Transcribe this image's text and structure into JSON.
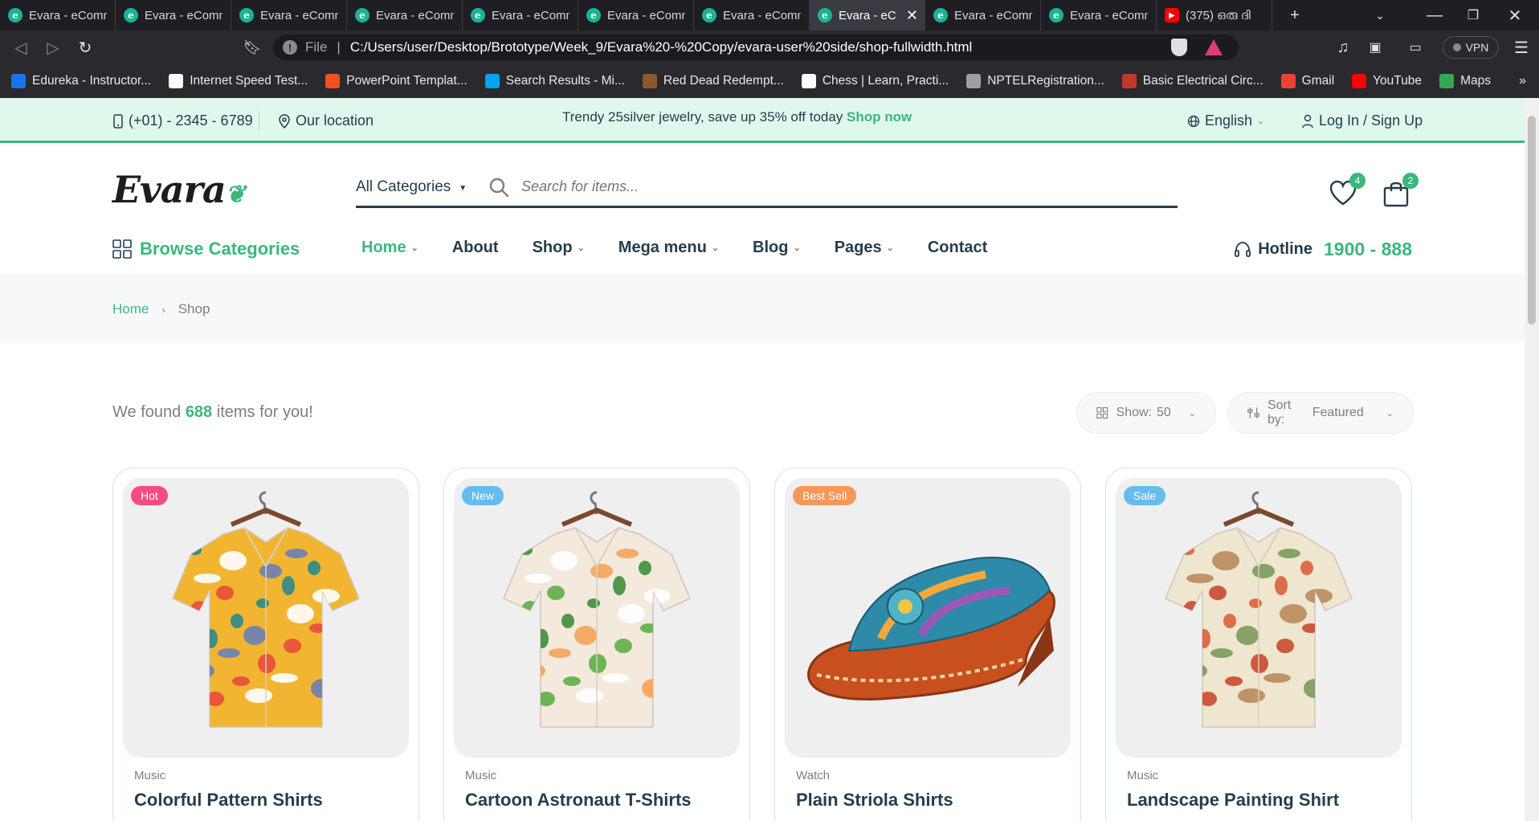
{
  "browser": {
    "tabs": [
      {
        "title": "Evara - eComm",
        "type": "site"
      },
      {
        "title": "Evara - eComm",
        "type": "site"
      },
      {
        "title": "Evara - eComm",
        "type": "site"
      },
      {
        "title": "Evara - eComm",
        "type": "site"
      },
      {
        "title": "Evara - eComm",
        "type": "site"
      },
      {
        "title": "Evara - eComm",
        "type": "site"
      },
      {
        "title": "Evara - eComm",
        "type": "site"
      },
      {
        "title": "Evara - eC",
        "type": "site",
        "active": true
      },
      {
        "title": "Evara - eComm",
        "type": "site"
      },
      {
        "title": "Evara - eComm",
        "type": "site"
      },
      {
        "title": "(375) ഒരു ദി",
        "type": "youtube"
      }
    ],
    "url_scheme": "File",
    "url": "C:/Users/user/Desktop/Brototype/Week_9/Evara%20-%20Copy/evara-user%20side/shop-fullwidth.html",
    "vpn_label": "VPN",
    "bookmarks": [
      {
        "label": "Edureka - Instructor...",
        "color": "#1a73e8"
      },
      {
        "label": "Internet Speed Test...",
        "color": "#ffffff"
      },
      {
        "label": "PowerPoint Templat...",
        "color": "#f25022"
      },
      {
        "label": "Search Results - Mi...",
        "color": "#00a4ef"
      },
      {
        "label": "Red Dead Redempt...",
        "color": "#8b5a2b"
      },
      {
        "label": "Chess | Learn, Practi...",
        "color": "#ffffff"
      },
      {
        "label": "NPTELRegistration...",
        "color": "#9aa0a6"
      },
      {
        "label": "Basic Electrical Circ...",
        "color": "#c0392b"
      },
      {
        "label": "Gmail",
        "color": "#ea4335"
      },
      {
        "label": "YouTube",
        "color": "#ff0000"
      },
      {
        "label": "Maps",
        "color": "#34a853"
      }
    ]
  },
  "topbar": {
    "phone": "(+01) - 2345 - 6789",
    "location": "Our location",
    "promo": "Trendy 25silver jewelry, save up 35% off today",
    "promo_link": "Shop now",
    "language": "English",
    "login": "Log In / Sign Up"
  },
  "header": {
    "logo": "Evara",
    "category_select": "All Categories",
    "search_placeholder": "Search for items...",
    "wishlist_count": "4",
    "cart_count": "2"
  },
  "nav": {
    "browse": "Browse Categories",
    "items": [
      {
        "label": "Home",
        "dropdown": true,
        "active": true
      },
      {
        "label": "About",
        "dropdown": false
      },
      {
        "label": "Shop",
        "dropdown": true
      },
      {
        "label": "Mega menu",
        "dropdown": true
      },
      {
        "label": "Blog",
        "dropdown": true
      },
      {
        "label": "Pages",
        "dropdown": true
      },
      {
        "label": "Contact",
        "dropdown": false
      }
    ],
    "hotline_label": "Hotline",
    "hotline_number": "1900 - 888"
  },
  "breadcrumb": {
    "home": "Home",
    "current": "Shop"
  },
  "listing": {
    "found_prefix": "We found",
    "found_count": "688",
    "found_suffix": "items for you!",
    "show_label": "Show:",
    "show_value": "50",
    "sort_label": "Sort by:",
    "sort_value": "Featured"
  },
  "products": [
    {
      "tag": "Hot",
      "tag_color": "#f74b81",
      "category": "Music",
      "title": "Colorful Pattern Shirts",
      "image": "shirt-colorful"
    },
    {
      "tag": "New",
      "tag_color": "#67bcee",
      "category": "Music",
      "title": "Cartoon Astronaut T-Shirts",
      "image": "shirt-floral"
    },
    {
      "tag": "Best Sell",
      "tag_color": "#f59758",
      "category": "Watch",
      "title": "Plain Striola Shirts",
      "image": "sandal"
    },
    {
      "tag": "Sale",
      "tag_color": "#67bcee",
      "category": "Music",
      "title": "Landscape Painting Shirt",
      "image": "shirt-mushroom"
    }
  ],
  "colors": {
    "brand": "#3bb77e",
    "text": "#253d4e",
    "muted": "#7e7e7e"
  }
}
